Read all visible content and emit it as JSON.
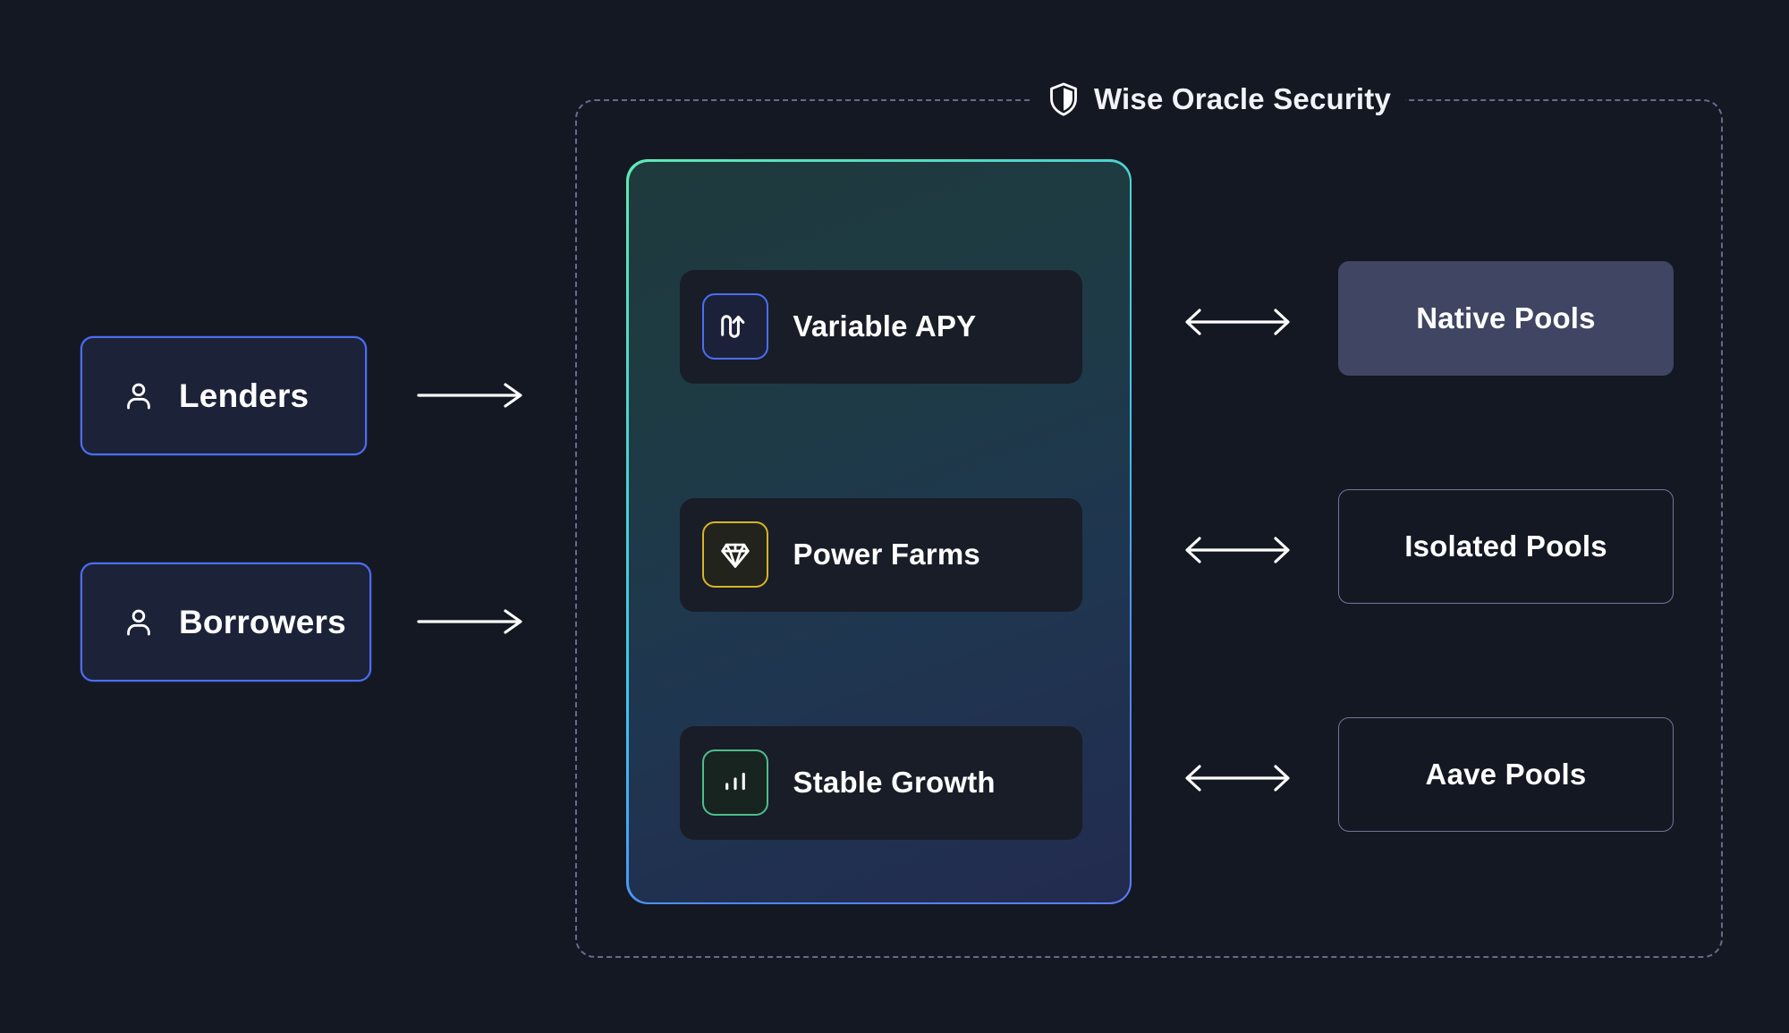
{
  "background_color": "#141823",
  "security_group": {
    "title": "Wise Oracle Security",
    "icon": "shield-icon",
    "border_style": "dashed",
    "border_color": "#646c8c"
  },
  "actors": [
    {
      "label": "Lenders",
      "icon": "person-icon",
      "border_color": "#4c6ef5",
      "fill_color": "#1c2238"
    },
    {
      "label": "Borrowers",
      "icon": "person-icon",
      "border_color": "#4c6ef5",
      "fill_color": "#1c2238"
    }
  ],
  "flow_arrows": [
    {
      "name": "lenders-to-platform-arrow",
      "direction": "right",
      "color": "#ffffff"
    },
    {
      "name": "borrowers-to-platform-arrow",
      "direction": "right",
      "color": "#ffffff"
    }
  ],
  "feature_panel": {
    "gradient_from": "#5eeab4",
    "gradient_mid": "#3fc6ec",
    "gradient_to": "#5c7cfa",
    "features": [
      {
        "label": "Variable APY",
        "icon": "variable-apy-arrow-icon",
        "accent_color": "#4c6ef5"
      },
      {
        "label": "Power Farms",
        "icon": "diamond-gem-icon",
        "accent_color": "#d8b426"
      },
      {
        "label": "Stable Growth",
        "icon": "bar-chart-icon",
        "accent_color": "#4fbd8d"
      }
    ]
  },
  "link_arrows": [
    {
      "name": "variable-apy-to-native-pools-arrow",
      "direction": "both",
      "color": "#ffffff"
    },
    {
      "name": "power-farms-to-isolated-pools-arrow",
      "direction": "both",
      "color": "#ffffff"
    },
    {
      "name": "stable-growth-to-aave-pools-arrow",
      "direction": "both",
      "color": "#ffffff"
    }
  ],
  "pools": [
    {
      "label": "Native Pools",
      "style": "filled",
      "fill_color": "#3f4562"
    },
    {
      "label": "Isolated Pools",
      "style": "outlined",
      "border_color": "#6f789b"
    },
    {
      "label": "Aave Pools",
      "style": "outlined",
      "border_color": "#6f789b"
    }
  ]
}
